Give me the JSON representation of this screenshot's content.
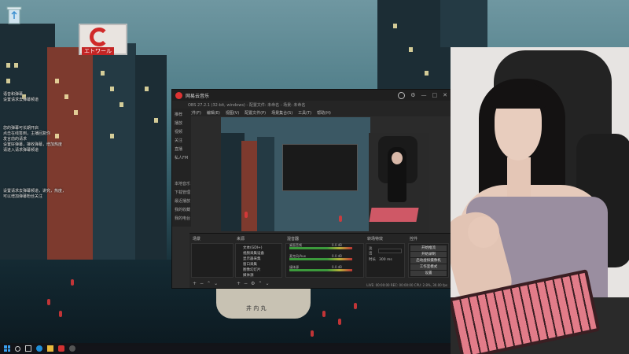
{
  "desktop": {
    "icons": [
      {
        "name": "recycle-bin-icon"
      }
    ],
    "overlay_lines_1": [
      "语音和弹幕",
      "设置请求去弹幕频道"
    ],
    "overlay_lines_2": [
      "您的弹幕可长期开启",
      "点击在线签到，主播回复你",
      "发言前的请求",
      "设置好弹幕，接收弹幕，增加热度",
      "请进入请求弹幕频道"
    ],
    "overlay_lines_3": [
      "设置请求去弹幕频道，讲究，热度，",
      "可以增加弹幕粉丝关注"
    ]
  },
  "wallpaper": {
    "sign_text": "エトワール",
    "boat_text": "井 内 丸"
  },
  "obs": {
    "app_title": "网易云音乐",
    "window_title": "OBS 27.2.1 (32-bit, windows) - 配置文件: 未命名 - 场景: 未命名",
    "menu": [
      "文件(F)",
      "编辑(E)",
      "视图(V)",
      "配置文件(P)",
      "场景集合(S)",
      "工具(T)",
      "帮助(H)"
    ],
    "sidebar": [
      "推荐",
      "播放",
      "视频",
      "关注",
      "直播",
      "私人FM",
      "",
      "",
      "本地音乐",
      "下载管理",
      "最近播放",
      "我的收藏",
      "我的电台"
    ],
    "panels": {
      "scenes": "场景",
      "sources": "来源",
      "mixer": "混音器",
      "transitions": "转场特效",
      "controls": "控件"
    },
    "sources": [
      "文本(GDI+)",
      "视频采集设备",
      "显示器采集",
      "窗口采集",
      "图像幻灯片",
      "媒体源"
    ],
    "mixer": [
      {
        "label": "桌面音频",
        "value": "0.0 dB"
      },
      {
        "label": "麦克风/Aux",
        "value": "0.0 dB"
      },
      {
        "label": "媒体源",
        "value": "0.0 dB"
      }
    ],
    "transition": {
      "type": "淡出",
      "duration_label": "时长",
      "duration": "300 ms"
    },
    "controls": [
      "开始推流",
      "开始录制",
      "启动虚拟摄像机",
      "工作室模式",
      "设置",
      "退出"
    ],
    "status": "LIVE: 00:00:00  REC: 00:00:00  CPU: 2.8%, 30.00 fps"
  },
  "taskbar": {
    "items": [
      "windows-start-icon",
      "search-icon",
      "task-view-icon",
      "edge-icon",
      "file-explorer-icon",
      "music-icon",
      "obs-icon"
    ]
  },
  "colors": {
    "accent_red": "#d33232",
    "obs_bg": "#2b2b2b",
    "keyboard_pink": "#e27c89"
  }
}
